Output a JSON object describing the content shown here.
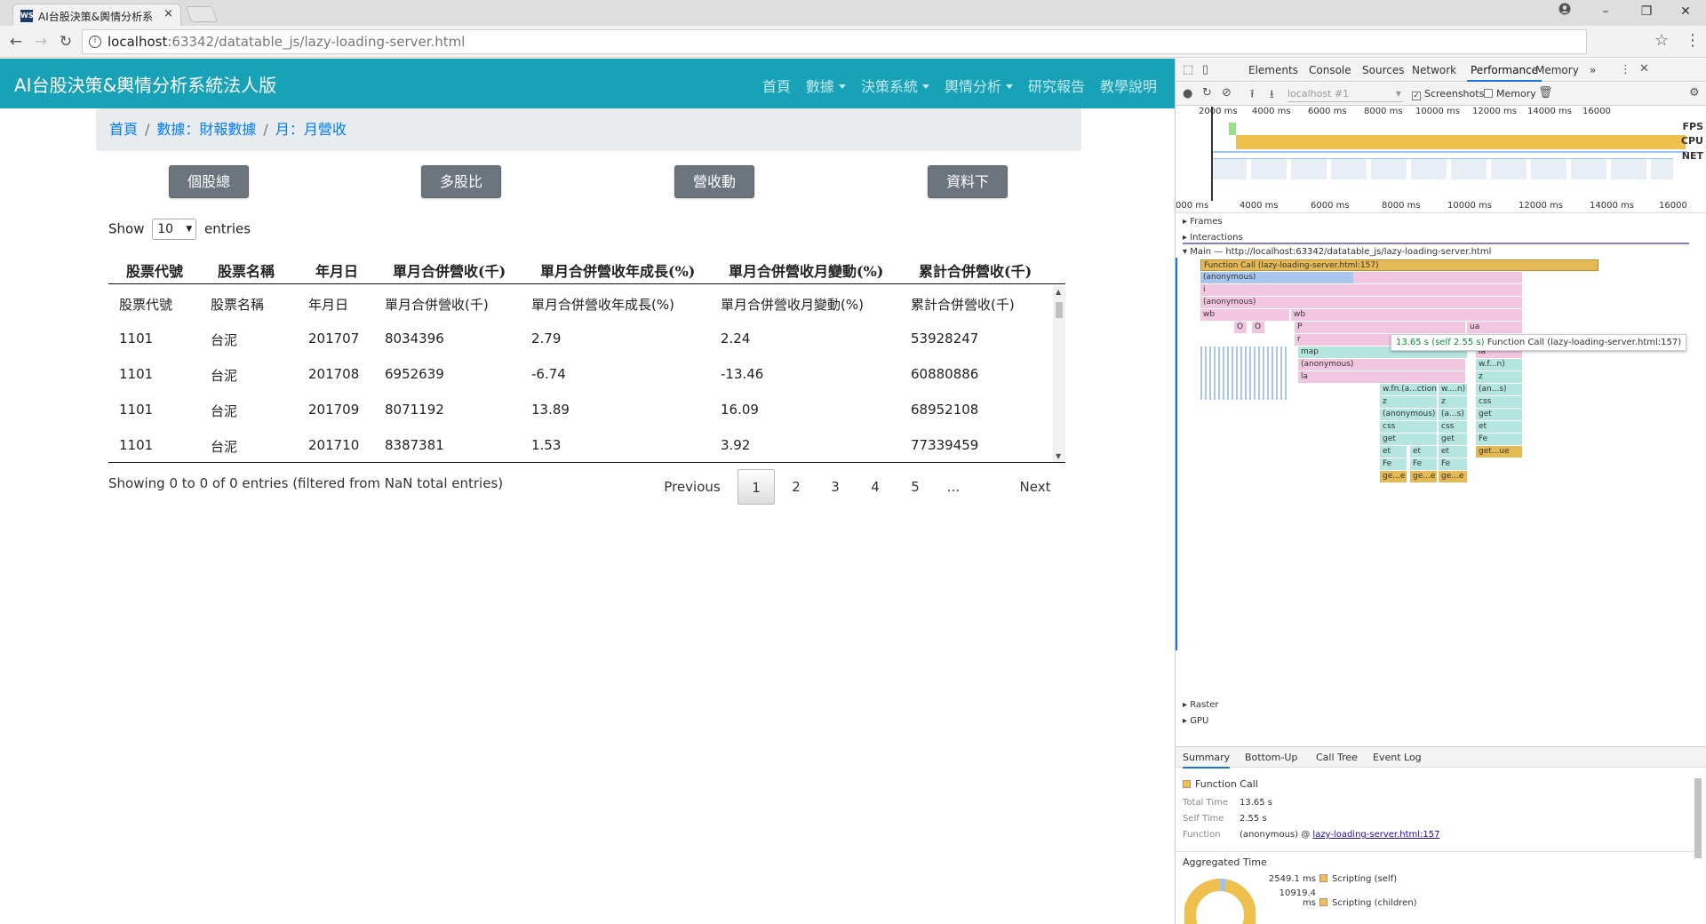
{
  "browser": {
    "tab_title": "AI台股決策&輿情分析系",
    "tab_close": "×",
    "favicon_text": "WS",
    "url_host": "localhost",
    "url_path": ":63342/datatable_js/lazy-loading-server.html",
    "minimize": "–",
    "maximize": "❐",
    "close": "✕"
  },
  "site": {
    "brand": "AI台股決策&輿情分析系統法人版",
    "nav": [
      "首頁",
      "數據",
      "決策系統",
      "輿情分析",
      "研究報告",
      "教學說明"
    ],
    "breadcrumb": [
      "首頁",
      "數據：財報數據",
      "月：月營收"
    ],
    "buttons": [
      "個股總覽",
      "多股比較",
      "營收動態",
      "資料下載"
    ],
    "accent": "#17a2b8"
  },
  "datatable": {
    "show_label": "Show",
    "length_value": "10",
    "entries_label": "entries",
    "header_columns": [
      "股票代號",
      "股票名稱",
      "年月日",
      "單月合併營收(千)",
      "單月合併營收年成長(%)",
      "單月合併營收月變動(%)",
      "累計合併營收(千)"
    ],
    "rows": [
      [
        "股票代號",
        "股票名稱",
        "年月日",
        "單月合併營收(千)",
        "單月合併營收年成長(%)",
        "單月合併營收月變動(%)",
        "累計合併營收(千)"
      ],
      [
        "1101",
        "台泥",
        "201707",
        "8034396",
        "2.79",
        "2.24",
        "53928247"
      ],
      [
        "1101",
        "台泥",
        "201708",
        "6952639",
        "-6.74",
        "-13.46",
        "60880886"
      ],
      [
        "1101",
        "台泥",
        "201709",
        "8071192",
        "13.89",
        "16.09",
        "68952108"
      ],
      [
        "1101",
        "台泥",
        "201710",
        "8387381",
        "1.53",
        "3.92",
        "77339459"
      ]
    ],
    "info": "Showing 0 to 0 of 0 entries (filtered from NaN total entries)",
    "pagination": [
      "Previous",
      "1",
      "2",
      "3",
      "4",
      "5",
      "…",
      "Next"
    ],
    "current_page": "1"
  },
  "devtools": {
    "tabs": [
      "Elements",
      "Console",
      "Sources",
      "Network",
      "Performance",
      "Memory"
    ],
    "more_tabs": "»",
    "active_tab": "Performance",
    "profile_select": "localhost #1",
    "screenshots_label": "Screenshots",
    "memory_label": "Memory",
    "overview_ticks": [
      "2000 ms",
      "4000 ms",
      "6000 ms",
      "8000 ms",
      "10000 ms",
      "12000 ms",
      "14000 ms",
      "16000"
    ],
    "ruler_ticks": [
      "000 ms",
      "4000 ms",
      "6000 ms",
      "8000 ms",
      "10000 ms",
      "12000 ms",
      "14000 ms",
      "16000"
    ],
    "overview_labels": [
      "FPS",
      "CPU",
      "NET"
    ],
    "tracks": [
      "Frames",
      "Interactions",
      "Main — http://localhost:63342/datatable_js/lazy-loading-server.html",
      "Raster",
      "GPU"
    ],
    "flame_labels": {
      "function_call": "Function Call (lazy-loading-server.html:157)",
      "anonymous": "(anonymous)",
      "i": "i",
      "wb": "wb",
      "o": "O",
      "p": "P",
      "r": "r",
      "map": "map",
      "la": "la",
      "ua": "ua",
      "s": "$",
      "wfn": "w.f...n)",
      "z": "z",
      "ans": "(an...s)",
      "css": "css",
      "get": "get",
      "et": "et",
      "fe": "Fe",
      "getue": "get...ue",
      "wfn_action": "w.fn.(a...ction)",
      "wn": "w....n)",
      "as": "(a...s)",
      "gee": "ge...e"
    },
    "tooltip_time": "13.65 s (self 2.55 s)",
    "tooltip_label": "Function Call (lazy-loading-server.html:157)",
    "bottom_tabs": [
      "Summary",
      "Bottom-Up",
      "Call Tree",
      "Event Log"
    ],
    "summary": {
      "title": "Function Call",
      "total_time_label": "Total Time",
      "total_time": "13.65 s",
      "self_time_label": "Self Time",
      "self_time": "2.55 s",
      "function_label": "Function",
      "function_value": "(anonymous) @",
      "function_link": "lazy-loading-server.html:157",
      "aggregated_label": "Aggregated Time",
      "agg_rows": [
        {
          "value": "2549.1 ms",
          "label": "Scripting (self)"
        },
        {
          "value": "10919.4 ms",
          "label": "Scripting (children)"
        }
      ]
    }
  }
}
